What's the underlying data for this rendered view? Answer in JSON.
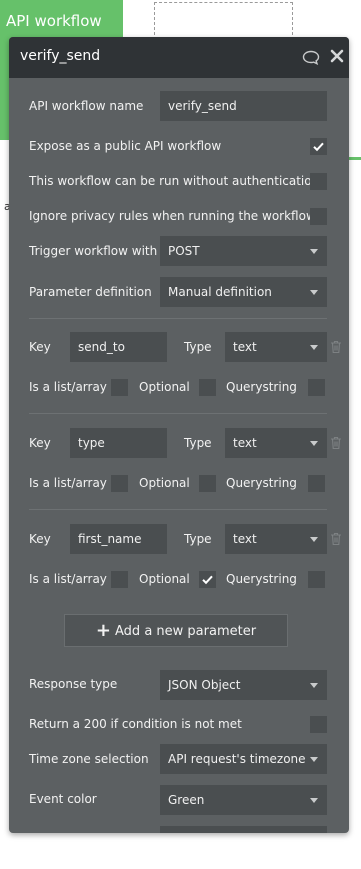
{
  "background": {
    "tab_label": "API workflow",
    "fragment_text": "a"
  },
  "panel": {
    "title": "verify_send",
    "fields": {
      "workflow_name_label": "API workflow name",
      "workflow_name_value": "verify_send",
      "expose_label": "Expose as a public API workflow",
      "expose_checked": true,
      "no_auth_label": "This workflow can be run without authentication",
      "no_auth_checked": false,
      "ignore_privacy_label": "Ignore privacy rules when running the workflow",
      "ignore_privacy_checked": false,
      "trigger_label": "Trigger workflow with",
      "trigger_value": "POST",
      "param_def_label": "Parameter definition",
      "param_def_value": "Manual definition"
    },
    "parameters": [
      {
        "key_label": "Key",
        "key_value": "send_to",
        "type_label": "Type",
        "type_value": "text",
        "list_label": "Is a list/array",
        "list_checked": false,
        "optional_label": "Optional",
        "optional_checked": false,
        "querystring_label": "Querystring",
        "querystring_checked": false
      },
      {
        "key_label": "Key",
        "key_value": "type",
        "type_label": "Type",
        "type_value": "text",
        "list_label": "Is a list/array",
        "list_checked": false,
        "optional_label": "Optional",
        "optional_checked": false,
        "querystring_label": "Querystring",
        "querystring_checked": false
      },
      {
        "key_label": "Key",
        "key_value": "first_name",
        "type_label": "Type",
        "type_value": "text",
        "list_label": "Is a list/array",
        "list_checked": false,
        "optional_label": "Optional",
        "optional_checked": true,
        "querystring_label": "Querystring",
        "querystring_checked": false
      }
    ],
    "add_parameter_label": "Add a new parameter",
    "response_type_label": "Response type",
    "response_type_value": "JSON Object",
    "return_200_label": "Return a 200 if condition is not met",
    "return_200_checked": false,
    "timezone_label": "Time zone selection",
    "timezone_value": "API request's timezone",
    "event_color_label": "Event color",
    "event_color_value": "Green"
  },
  "colors": {
    "accent_green": "#66c16a",
    "panel_bg": "#5c6062",
    "header_bg": "#2f3336",
    "field_bg": "#4a4e50"
  }
}
